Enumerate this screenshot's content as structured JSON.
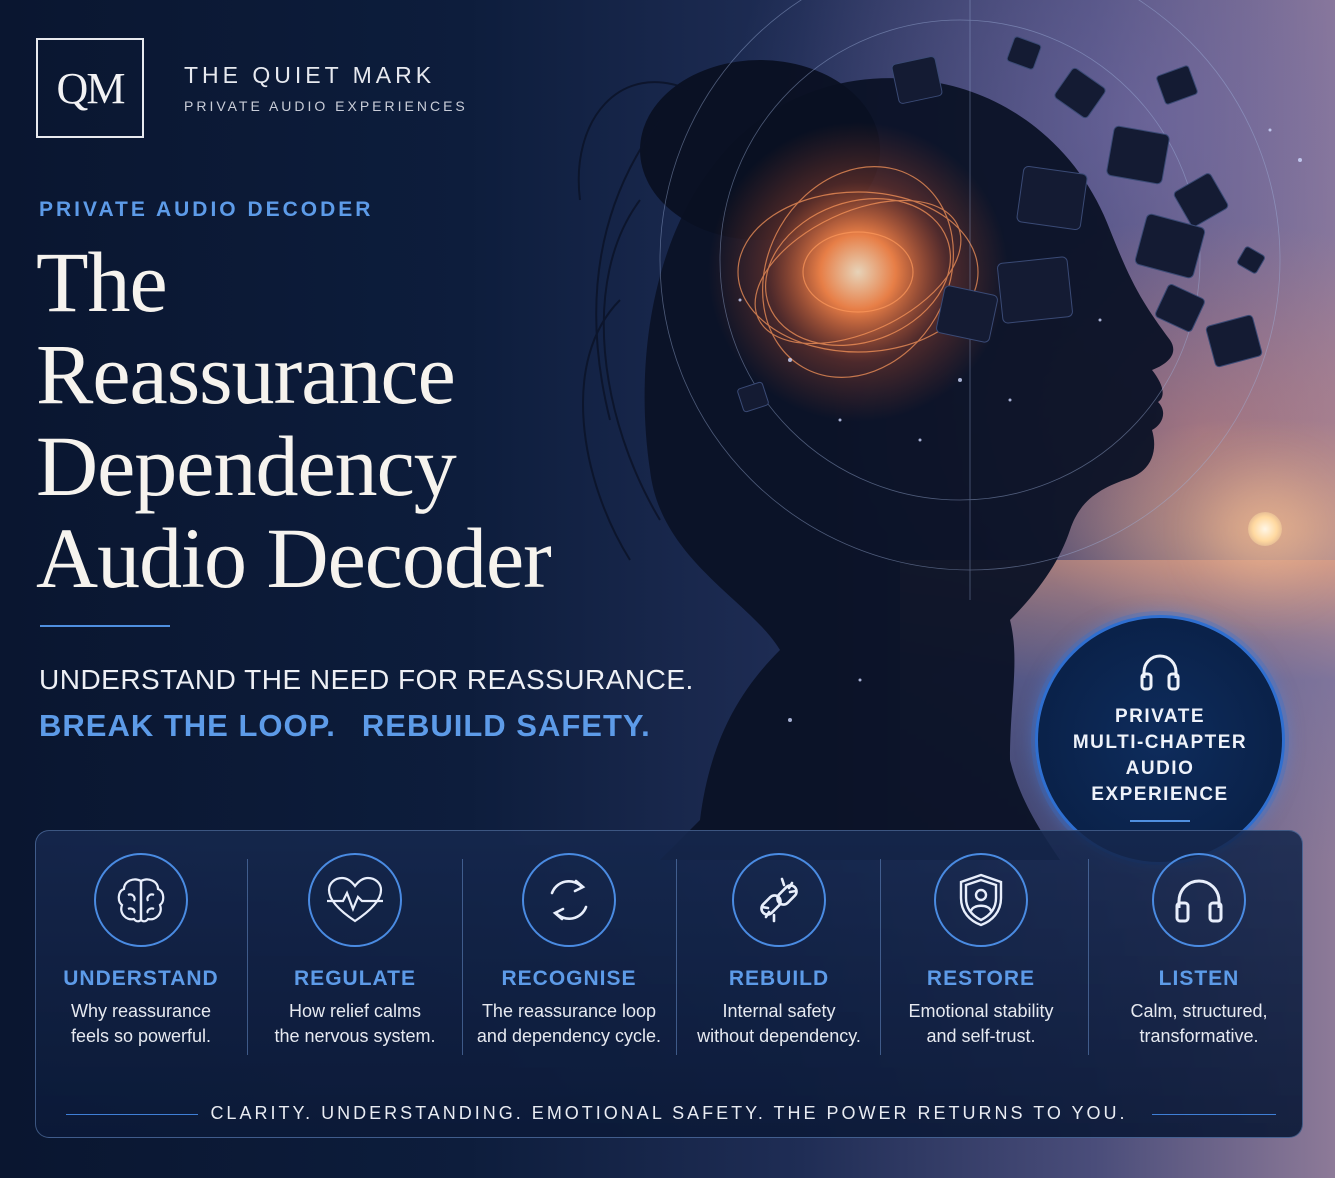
{
  "brand": {
    "monogram": "QM",
    "name": "THE QUIET MARK",
    "tagline": "PRIVATE AUDIO EXPERIENCES"
  },
  "hero": {
    "kicker": "PRIVATE AUDIO DECODER",
    "title_lines": [
      "The",
      "Reassurance",
      "Dependency",
      "Audio Decoder"
    ],
    "subtitle": "UNDERSTAND THE NEED FOR REASSURANCE.",
    "callouts": [
      "BREAK THE LOOP.",
      "REBUILD SAFETY."
    ]
  },
  "badge": {
    "icon": "headphones-icon",
    "lines": [
      "PRIVATE",
      "MULTI-CHAPTER",
      "AUDIO",
      "EXPERIENCE"
    ]
  },
  "features": [
    {
      "icon": "brain-icon",
      "name": "UNDERSTAND",
      "desc": "Why reassurance\nfeels so powerful."
    },
    {
      "icon": "heart-pulse-icon",
      "name": "REGULATE",
      "desc": "How relief calms\nthe nervous system."
    },
    {
      "icon": "cycle-arrows-icon",
      "name": "RECOGNISE",
      "desc": "The reassurance loop\nand dependency cycle."
    },
    {
      "icon": "broken-link-icon",
      "name": "REBUILD",
      "desc": "Internal safety\nwithout dependency."
    },
    {
      "icon": "shield-person-icon",
      "name": "RESTORE",
      "desc": "Emotional stability\nand self-trust."
    },
    {
      "icon": "headphones-icon",
      "name": "LISTEN",
      "desc": "Calm, structured,\ntransformative."
    }
  ],
  "footer": "CLARITY.  UNDERSTANDING.  EMOTIONAL SAFETY.   THE POWER RETURNS TO YOU.",
  "colors": {
    "accent": "#5d9be8",
    "background": "#0b1a33",
    "title": "#f6f3ee"
  }
}
